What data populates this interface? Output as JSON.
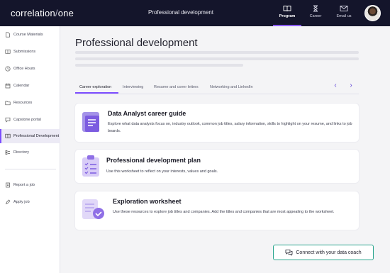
{
  "header": {
    "logo_left": "correlation",
    "logo_slash": "/",
    "logo_right": "one",
    "title": "Professional development",
    "nav": [
      {
        "label": "Program",
        "icon": "book-icon",
        "active": true
      },
      {
        "label": "Career",
        "icon": "hourglass-icon",
        "active": false
      },
      {
        "label": "Email us",
        "icon": "mail-icon",
        "active": false
      }
    ]
  },
  "sidebar": {
    "items": [
      {
        "label": "Course Materials",
        "icon": "file-icon"
      },
      {
        "label": "Submissions",
        "icon": "book-icon"
      },
      {
        "label": "Office Hours",
        "icon": "clock-icon"
      },
      {
        "label": "Calendar",
        "icon": "calendar-icon"
      },
      {
        "label": "Resources",
        "icon": "folder-icon"
      },
      {
        "label": "Capstone portal",
        "icon": "chat-icon"
      },
      {
        "label": "Professional Development",
        "icon": "book-open-icon",
        "active": true
      },
      {
        "label": "Directory",
        "icon": "directory-icon"
      },
      {
        "label": "Report a job",
        "icon": "report-icon"
      },
      {
        "label": "Apply job",
        "icon": "apply-icon"
      }
    ]
  },
  "main": {
    "title": "Professional development",
    "tabs": [
      {
        "label": "Career exploration",
        "active": true
      },
      {
        "label": "Interviewing"
      },
      {
        "label": "Resume and cover letters"
      },
      {
        "label": "Networking and LinkedIn"
      }
    ],
    "cards": [
      {
        "title": "Data Analyst career guide",
        "desc": "Explore what data analysts focus on, industry outlook, common job titles, salary information, skills to highlight on your resume, and links to job boards."
      },
      {
        "title": "Professional development plan",
        "desc": "Use this worksheet to reflect on your interests, values and goals."
      },
      {
        "title": "Exploration worksheet",
        "desc": "Use these resources to explore job titles and companies. Add the titles and companies that are most appealing to the worksheet."
      }
    ],
    "coach_button": "Connect with your data coach"
  },
  "colors": {
    "topbar": "#14152b",
    "accent": "#7c4dff",
    "coach_border": "#2aa58e"
  }
}
